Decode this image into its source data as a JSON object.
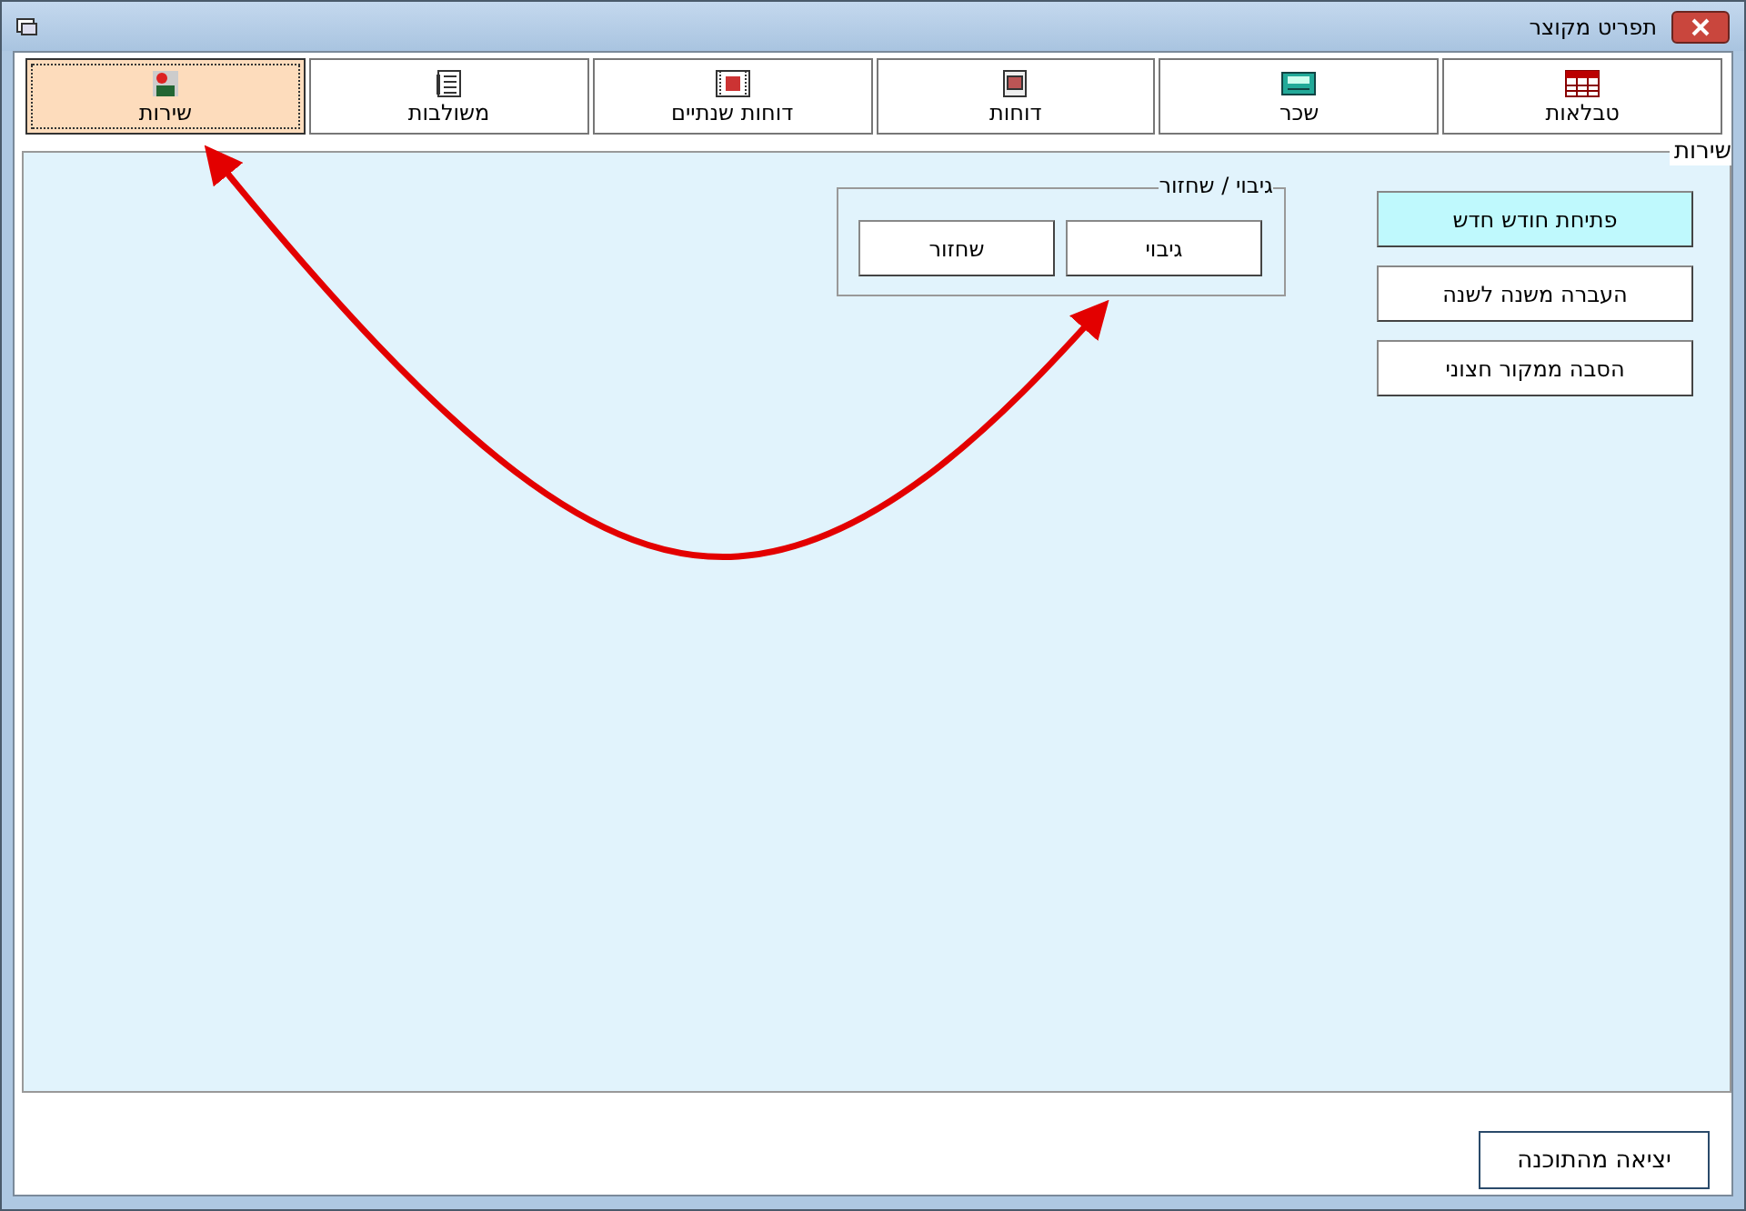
{
  "window": {
    "title": "תפריט מקוצר"
  },
  "tabs": [
    {
      "label": "טבלאות",
      "selected": false
    },
    {
      "label": "שכר",
      "selected": false
    },
    {
      "label": "דוחות",
      "selected": false
    },
    {
      "label": "דוחות שנתיים",
      "selected": false
    },
    {
      "label": "משולבות",
      "selected": false
    },
    {
      "label": "שירות",
      "selected": true
    }
  ],
  "panel": {
    "title": "שירות",
    "actions": [
      {
        "label": "פתיחת חודש חדש",
        "highlighted": true
      },
      {
        "label": "העברה משנה לשנה",
        "highlighted": false
      },
      {
        "label": "הסבה ממקור חצוני",
        "highlighted": false
      }
    ],
    "group": {
      "title": "גיבוי / שחזור",
      "buttons": [
        {
          "label": "גיבוי"
        },
        {
          "label": "שחזור"
        }
      ]
    }
  },
  "exit_button": {
    "label": "יציאה מהתוכנה"
  }
}
